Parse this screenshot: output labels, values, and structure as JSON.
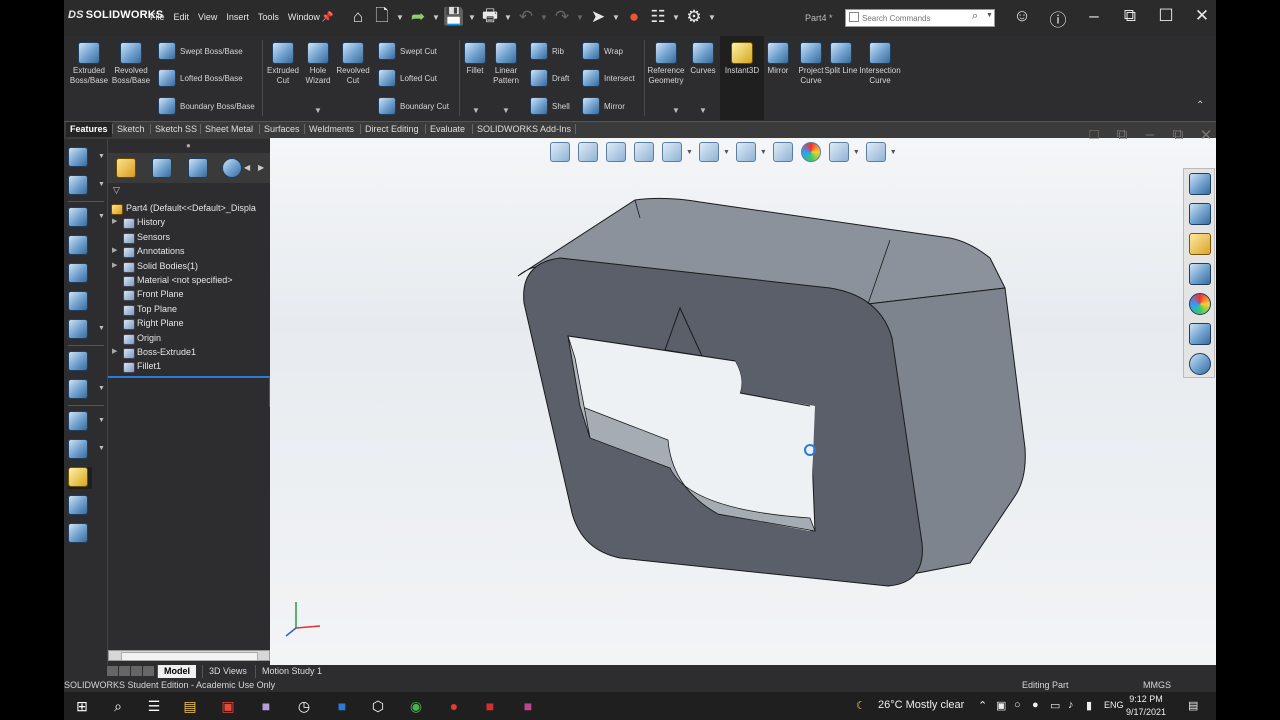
{
  "app": {
    "logo": "SOLIDWORKS",
    "menus": [
      "File",
      "Edit",
      "View",
      "Insert",
      "Tools",
      "Window"
    ],
    "document_title": "Part4 *",
    "search_placeholder": "Search Commands"
  },
  "ribbon": {
    "extruded_boss": "Extruded Boss/Base",
    "revolved_boss": "Revolved Boss/Base",
    "swept_boss": "Swept Boss/Base",
    "lofted_boss": "Lofted Boss/Base",
    "boundary_boss": "Boundary Boss/Base",
    "extruded_cut": "Extruded Cut",
    "hole_wizard": "Hole Wizard",
    "revolved_cut": "Revolved Cut",
    "swept_cut": "Swept Cut",
    "lofted_cut": "Lofted Cut",
    "boundary_cut": "Boundary Cut",
    "fillet": "Fillet",
    "linear_pattern": "Linear Pattern",
    "rib": "Rib",
    "wrap": "Wrap",
    "draft": "Draft",
    "intersect": "Intersect",
    "shell": "Shell",
    "mirror_small": "Mirror",
    "reference_geometry": "Reference Geometry",
    "curves": "Curves",
    "instant3d": "Instant3D",
    "mirror": "Mirror",
    "project_curve": "Project Curve",
    "split_line": "Split Line",
    "intersection_curve": "Intersection Curve"
  },
  "tabs": [
    "Features",
    "Sketch",
    "Sketch SS",
    "Sheet Metal",
    "Surfaces",
    "Weldments",
    "Direct Editing",
    "Evaluate",
    "SOLIDWORKS Add-Ins"
  ],
  "tree": {
    "root": "Part4  (Default<<Default>_Displa",
    "items": [
      "History",
      "Sensors",
      "Annotations",
      "Solid Bodies(1)",
      "Material <not specified>",
      "Front Plane",
      "Top Plane",
      "Right Plane",
      "Origin",
      "Boss-Extrude1",
      "Fillet1"
    ]
  },
  "bottom_tabs": [
    "Model",
    "3D Views",
    "Motion Study 1"
  ],
  "status": {
    "left": "SOLIDWORKS Student Edition - Academic Use Only",
    "mode": "Editing Part",
    "units": "MMGS"
  },
  "taskbar": {
    "weather": "26°C  Mostly clear",
    "language": "ENG",
    "time": "9:12 PM",
    "date": "9/17/2021"
  },
  "colors": {
    "ui_dark": "#2d2d30",
    "model_face": "#8e949d",
    "model_front": "#5b606a",
    "viewport_bg": "#eef1f4",
    "accent": "#2b7bd6"
  }
}
